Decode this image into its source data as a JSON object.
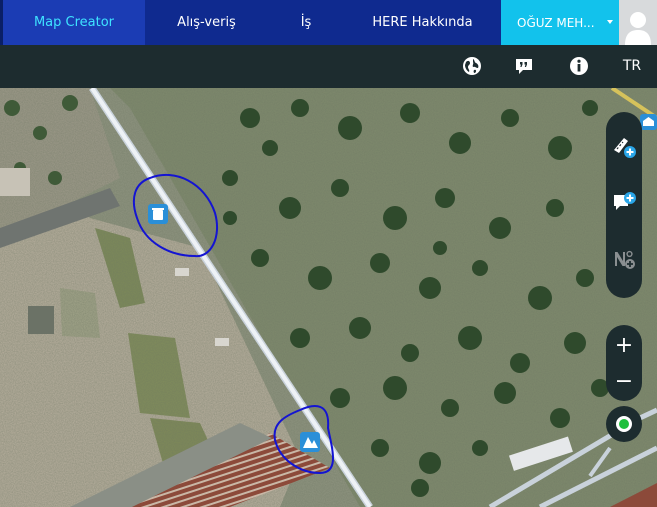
{
  "nav": {
    "tabs": [
      {
        "label": "Map Creator"
      },
      {
        "label": "Alış-veriş"
      },
      {
        "label": "İş"
      },
      {
        "label": "HERE Hakkında"
      }
    ],
    "user_name": "OĞUZ MEH...",
    "avatar_icon": "user-silhouette-icon"
  },
  "toolbar": {
    "icons": [
      "globe-icon",
      "feedback-bubble-icon",
      "info-icon"
    ],
    "language": "TR"
  },
  "map_controls": {
    "tools": [
      "add-road-icon",
      "add-comment-icon",
      "add-house-number-icon"
    ],
    "zoom_in": "+",
    "zoom_out": "−",
    "locate_icon": "my-location-icon"
  },
  "colors": {
    "nav_bg": "#0f2a8f",
    "active_tab": "#1b3cb4",
    "active_text": "#3ee3ff",
    "user_menu": "#12c2ec",
    "toolbar_bg": "#1d2c2f",
    "annotation_circle": "#1414d2",
    "poi_marker": "#2a8fd8"
  },
  "poi_markers": [
    "waste-bin-poi-icon",
    "park-poi-icon"
  ],
  "corner_poi": "building-poi-icon"
}
